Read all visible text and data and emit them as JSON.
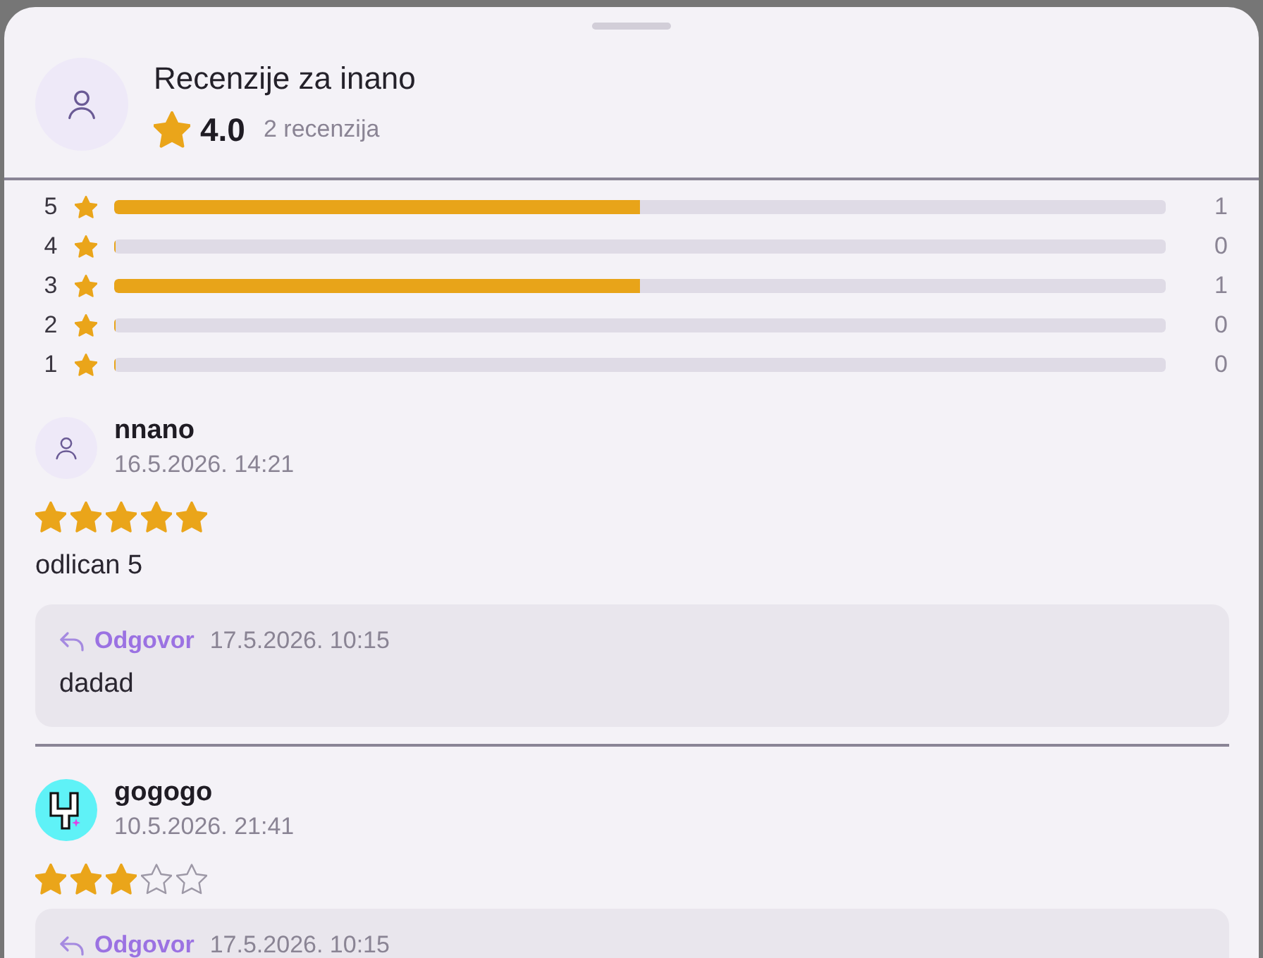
{
  "header": {
    "title": "Recenzije za inano",
    "average": "4.0",
    "count": "2 recenzija"
  },
  "distribution": [
    {
      "label": "5",
      "level": 0.5,
      "count": "1"
    },
    {
      "label": "4",
      "level": 0,
      "count": "0"
    },
    {
      "label": "3",
      "level": 0.5,
      "count": "1"
    },
    {
      "label": "2",
      "level": 0,
      "count": "0"
    },
    {
      "label": "1",
      "level": 0,
      "count": "0"
    }
  ],
  "reviews": [
    {
      "author": "nnano",
      "avatar": {
        "kind": "default"
      },
      "date": "16.5.2026. 14:21",
      "stars": 5,
      "text": "odlican 5",
      "reply": {
        "label": "Odgovor",
        "date": "17.5.2026. 10:15",
        "text": "dadad"
      }
    },
    {
      "author": "gogogo",
      "avatar": {
        "kind": "image"
      },
      "date": "10.5.2026. 21:41",
      "stars": 3,
      "reply": {
        "label": "Odgovor",
        "date": "17.5.2026. 10:15"
      }
    }
  ]
}
